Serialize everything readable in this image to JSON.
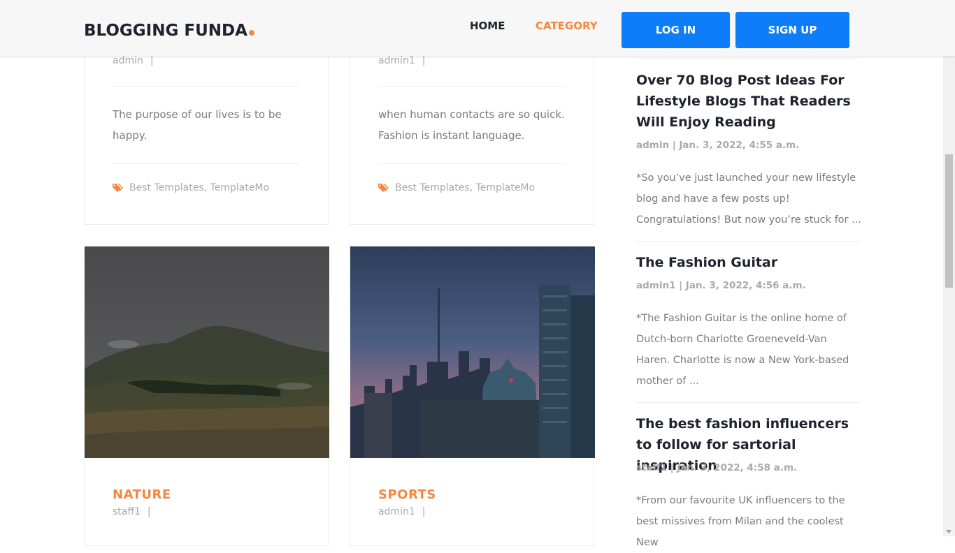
{
  "header": {
    "logo": "BLOGGING FUNDA",
    "nav": {
      "home": "HOME",
      "category": "CATEGORY"
    },
    "login_label": "LOG IN",
    "signup_label": "SIGN UP"
  },
  "colors": {
    "accent": "#f48840",
    "button": "#0d7dfa",
    "text": "#20232e",
    "muted": "#aaaaaa"
  },
  "posts": [
    {
      "author": "admin",
      "separator": "|",
      "excerpt": "The purpose of our lives is to be happy.",
      "tags": [
        "Best Templates",
        "TemplateMo"
      ],
      "tag_icon": "tags-icon"
    },
    {
      "author": "admin1",
      "separator": "|",
      "excerpt": "when human contacts are so quick. Fashion is instant language.",
      "tags": [
        "Best Templates",
        "TemplateMo"
      ],
      "tag_icon": "tags-icon"
    }
  ],
  "categories": [
    {
      "title": "NATURE",
      "author": "staff1",
      "separator": "|",
      "image": "mountain-landscape-image"
    },
    {
      "title": "SPORTS",
      "author": "admin1",
      "separator": "|",
      "image": "city-skyline-image"
    }
  ],
  "sidebar": {
    "posts": [
      {
        "title": "Over 70 Blog Post Ideas For Lifestyle Blogs That Readers Will Enjoy Reading",
        "meta": "admin | Jan. 3, 2022, 4:55 a.m.",
        "excerpt": "*So you’ve just launched your new lifestyle blog and have a few posts up! Congratulations! But now you’re stuck for ..."
      },
      {
        "title": "The Fashion Guitar",
        "meta": "admin1 | Jan. 3, 2022, 4:56 a.m.",
        "excerpt": "*The Fashion Guitar is the online home of Dutch-born Charlotte Groeneveld-Van Haren. Charlotte is now a New York-based mother of ..."
      },
      {
        "title": "The best fashion influencers to follow for sartorial inspiration",
        "meta": "staff1 | Jan. 3, 2022, 4:58 a.m.",
        "excerpt": "*From our favourite UK influencers to the best missives from Milan and the coolest New"
      }
    ]
  }
}
